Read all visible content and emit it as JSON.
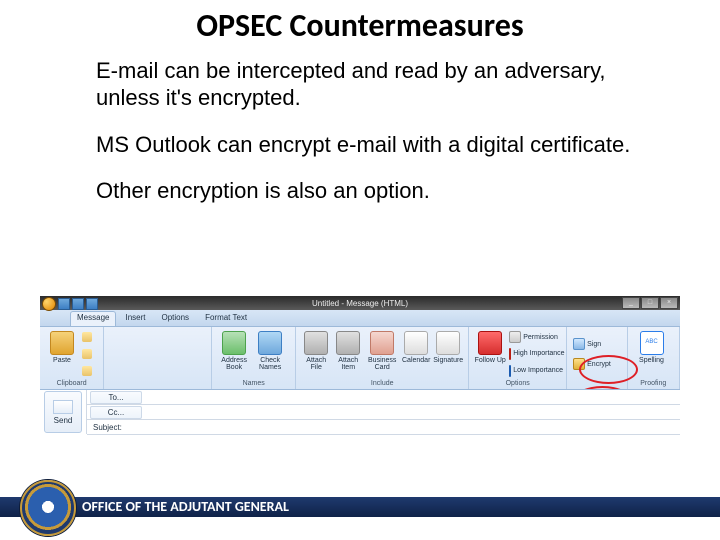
{
  "title": "OPSEC Countermeasures",
  "bullets": {
    "b1": "E-mail can be intercepted and read by an adversary, unless it's encrypted.",
    "b2": "MS Outlook can encrypt e-mail with a digital certificate.",
    "b3": "Other encryption is also an option."
  },
  "outlook": {
    "window_title": "Untitled - Message (HTML)",
    "tabs": {
      "t1": "Message",
      "t2": "Insert",
      "t3": "Options",
      "t4": "Format Text"
    },
    "groups": {
      "clipboard": {
        "label": "Clipboard",
        "paste": "Paste"
      },
      "names": {
        "label": "Names",
        "ab": "Address Book",
        "check": "Check Names"
      },
      "include": {
        "label": "Include",
        "attach_file": "Attach File",
        "attach_item": "Attach Item",
        "card": "Business Card",
        "cal": "Calendar",
        "sig": "Signature"
      },
      "options": {
        "label": "Options",
        "follow": "Follow Up",
        "perm": "Permission",
        "high": "High Importance",
        "low": "Low Importance",
        "sign": "Sign",
        "encrypt": "Encrypt"
      },
      "proof": {
        "label": "Proofing",
        "spell": "Spelling"
      }
    },
    "fields": {
      "send": "Send",
      "to": "To...",
      "cc": "Cc...",
      "subject": "Subject:"
    }
  },
  "footer": "OFFICE OF THE ADJUTANT GENERAL"
}
